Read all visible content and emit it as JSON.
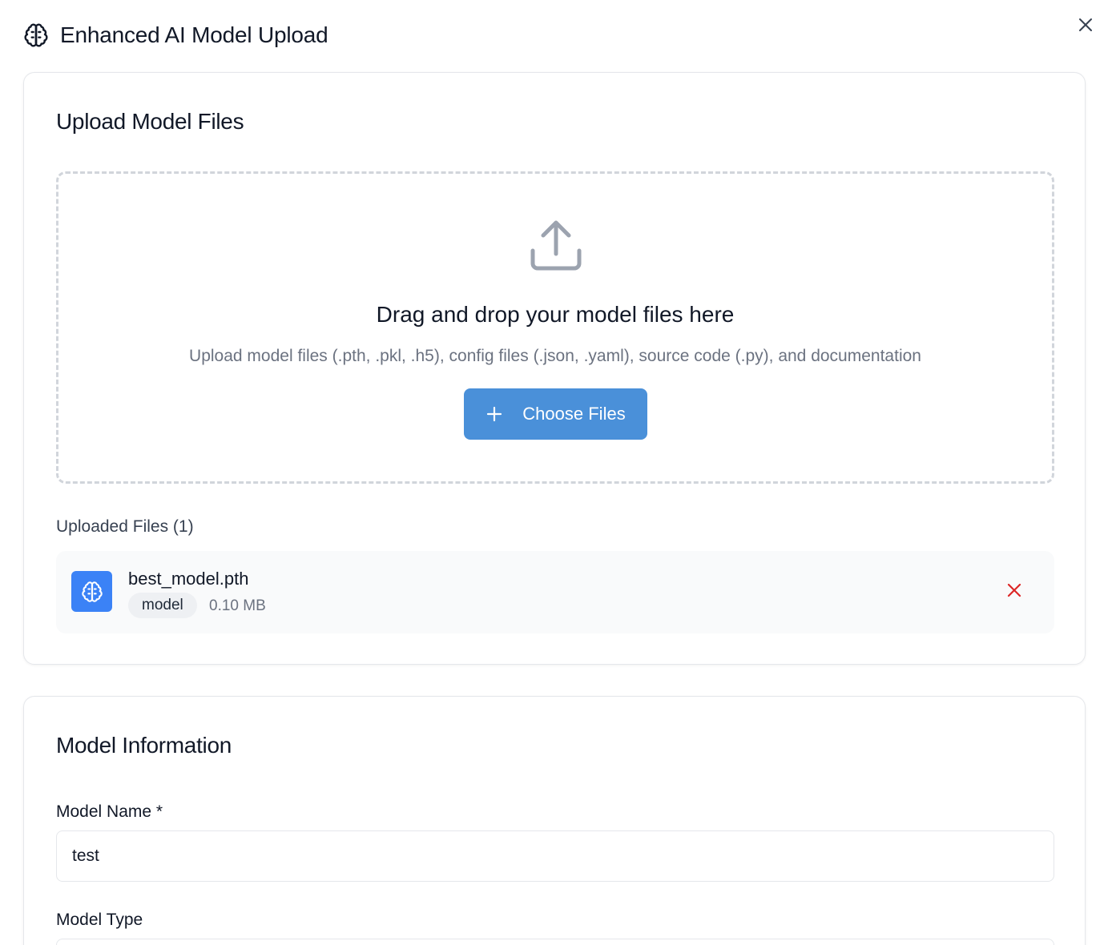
{
  "dialog": {
    "title": "Enhanced AI Model Upload",
    "title_icon": "brain-icon",
    "close_icon": "close-icon"
  },
  "upload_section": {
    "title": "Upload Model Files",
    "dropzone": {
      "icon": "upload-icon",
      "title": "Drag and drop your model files here",
      "subtitle": "Upload model files (.pth, .pkl, .h5), config files (.json, .yaml), source code (.py), and documentation",
      "button_label": "Choose Files",
      "button_icon": "plus-icon"
    },
    "uploaded_label": "Uploaded Files (1)",
    "files": [
      {
        "name": "best_model.pth",
        "type_tag": "model",
        "size": "0.10 MB",
        "icon": "brain-icon",
        "remove_icon": "close-icon"
      }
    ]
  },
  "info_section": {
    "title": "Model Information",
    "model_name_label": "Model Name *",
    "model_name_value": "test",
    "model_type_label": "Model Type"
  },
  "colors": {
    "primary_button": "#4a90d9",
    "file_icon_bg": "#3b82f6",
    "remove_icon": "#dc2626",
    "muted_text": "#6b7280"
  }
}
